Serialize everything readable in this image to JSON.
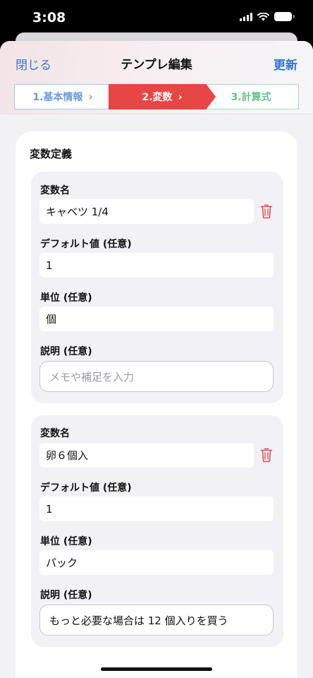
{
  "status": {
    "time": "3:08"
  },
  "nav": {
    "close": "閉じる",
    "title": "テンプレ編集",
    "update": "更新"
  },
  "steps": [
    {
      "label": "1.基本情報",
      "chevron": "›"
    },
    {
      "label": "2.変数",
      "chevron": "›"
    },
    {
      "label": "3.計算式"
    }
  ],
  "section_title": "変数定義",
  "labels": {
    "name": "変数名",
    "default": "デフォルト値 (任意)",
    "unit": "単位 (任意)",
    "description": "説明 (任意)"
  },
  "variables": [
    {
      "name": "キャベツ 1/4",
      "default": "1",
      "unit": "個",
      "description": "",
      "description_placeholder": "メモや補足を入力"
    },
    {
      "name": "卵６個入",
      "default": "1",
      "unit": "パック",
      "description": "もっと必要な場合は 12 個入りを買う",
      "description_placeholder": "メモや補足を入力"
    }
  ],
  "colors": {
    "accent_blue": "#2f74d8",
    "active_step": "#e84545",
    "delete_red": "#e05050",
    "step3_green": "#62c38a"
  },
  "icons": {
    "delete": "trash-icon",
    "wifi": "wifi-icon",
    "signal": "signal-icon",
    "battery": "battery-icon"
  }
}
